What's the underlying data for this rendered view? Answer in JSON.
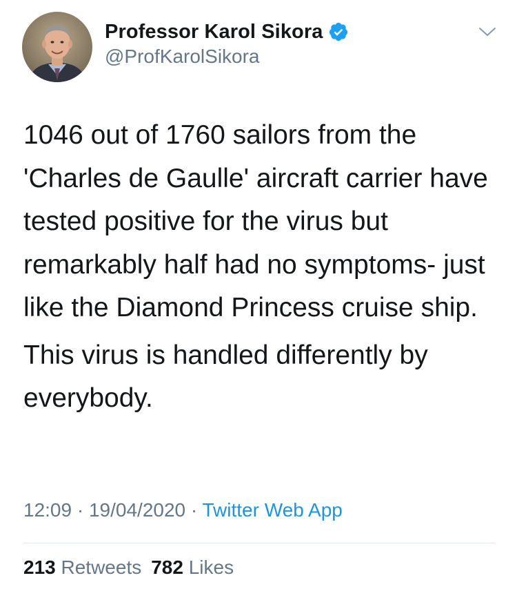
{
  "author": {
    "display_name": "Professor Karol Sikora",
    "handle": "@ProfKarolSikora",
    "verified_icon": "verified-badge-icon",
    "avatar_icon": "profile-photo"
  },
  "menu": {
    "icon": "chevron-down-icon"
  },
  "tweet": {
    "paragraphs": [
      "1046 out of 1760 sailors from the 'Charles de Gaulle' aircraft carrier have tested positive for the virus but remarkably half had no symptoms- just like the Diamond Princess cruise ship.",
      "This virus is handled differently by everybody."
    ]
  },
  "meta": {
    "time": "12:09",
    "sep1": " · ",
    "date": "19/04/2020",
    "sep2": " · ",
    "source": "Twitter Web App"
  },
  "stats": {
    "retweets_count": "213",
    "retweets_label": "Retweets",
    "likes_count": "782",
    "likes_label": "Likes"
  },
  "colors": {
    "text": "#14171a",
    "secondary": "#657786",
    "link": "#1b95e0",
    "verified": "#1da1f2",
    "divider": "#e1e8ed"
  }
}
